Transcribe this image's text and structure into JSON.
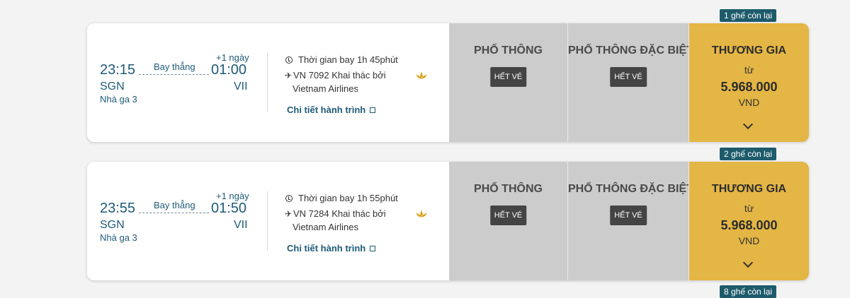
{
  "flights": [
    {
      "seats_left": "1 ghế còn lại",
      "dep_time": "23:15",
      "arr_time": "01:00",
      "plus_day": "+1 ngày",
      "direct": "Bay thẳng",
      "dep_code": "SGN",
      "arr_code": "VII",
      "terminal": "Nhà ga 3",
      "duration": "Thời gian bay 1h 45phút",
      "flight_no": "VN 7092 Khai thác bởi",
      "operator": "Vietnam Airlines",
      "detail_link": "Chi tiết hành trình",
      "fares": {
        "economy": {
          "title": "PHỔ THÔNG",
          "status": "HẾT VÉ"
        },
        "premium": {
          "title": "PHỔ THÔNG ĐẶC BIỆT",
          "status": "HẾT VÉ"
        },
        "business": {
          "title": "THƯƠNG GIA",
          "from": "từ",
          "price": "5.968.000",
          "currency": "VND"
        }
      }
    },
    {
      "seats_left": "2 ghế còn lại",
      "dep_time": "23:55",
      "arr_time": "01:50",
      "plus_day": "+1 ngày",
      "direct": "Bay thẳng",
      "dep_code": "SGN",
      "arr_code": "VII",
      "terminal": "Nhà ga 3",
      "duration": "Thời gian bay 1h 55phút",
      "flight_no": "VN 7284 Khai thác bởi",
      "operator": "Vietnam Airlines",
      "detail_link": "Chi tiết hành trình",
      "fares": {
        "economy": {
          "title": "PHỔ THÔNG",
          "status": "HẾT VÉ"
        },
        "premium": {
          "title": "PHỔ THÔNG ĐẶC BIỆT",
          "status": "HẾT VÉ"
        },
        "business": {
          "title": "THƯƠNG GIA",
          "from": "từ",
          "price": "5.968.000",
          "currency": "VND"
        }
      }
    }
  ],
  "next_seats_left": "8 ghế còn lại",
  "colors": {
    "accent": "#1e5a78",
    "business_fare": "#e4b645",
    "unavailable_fare": "#cccccc",
    "badge": "#1d5b6b",
    "soldout_button": "#444444"
  }
}
